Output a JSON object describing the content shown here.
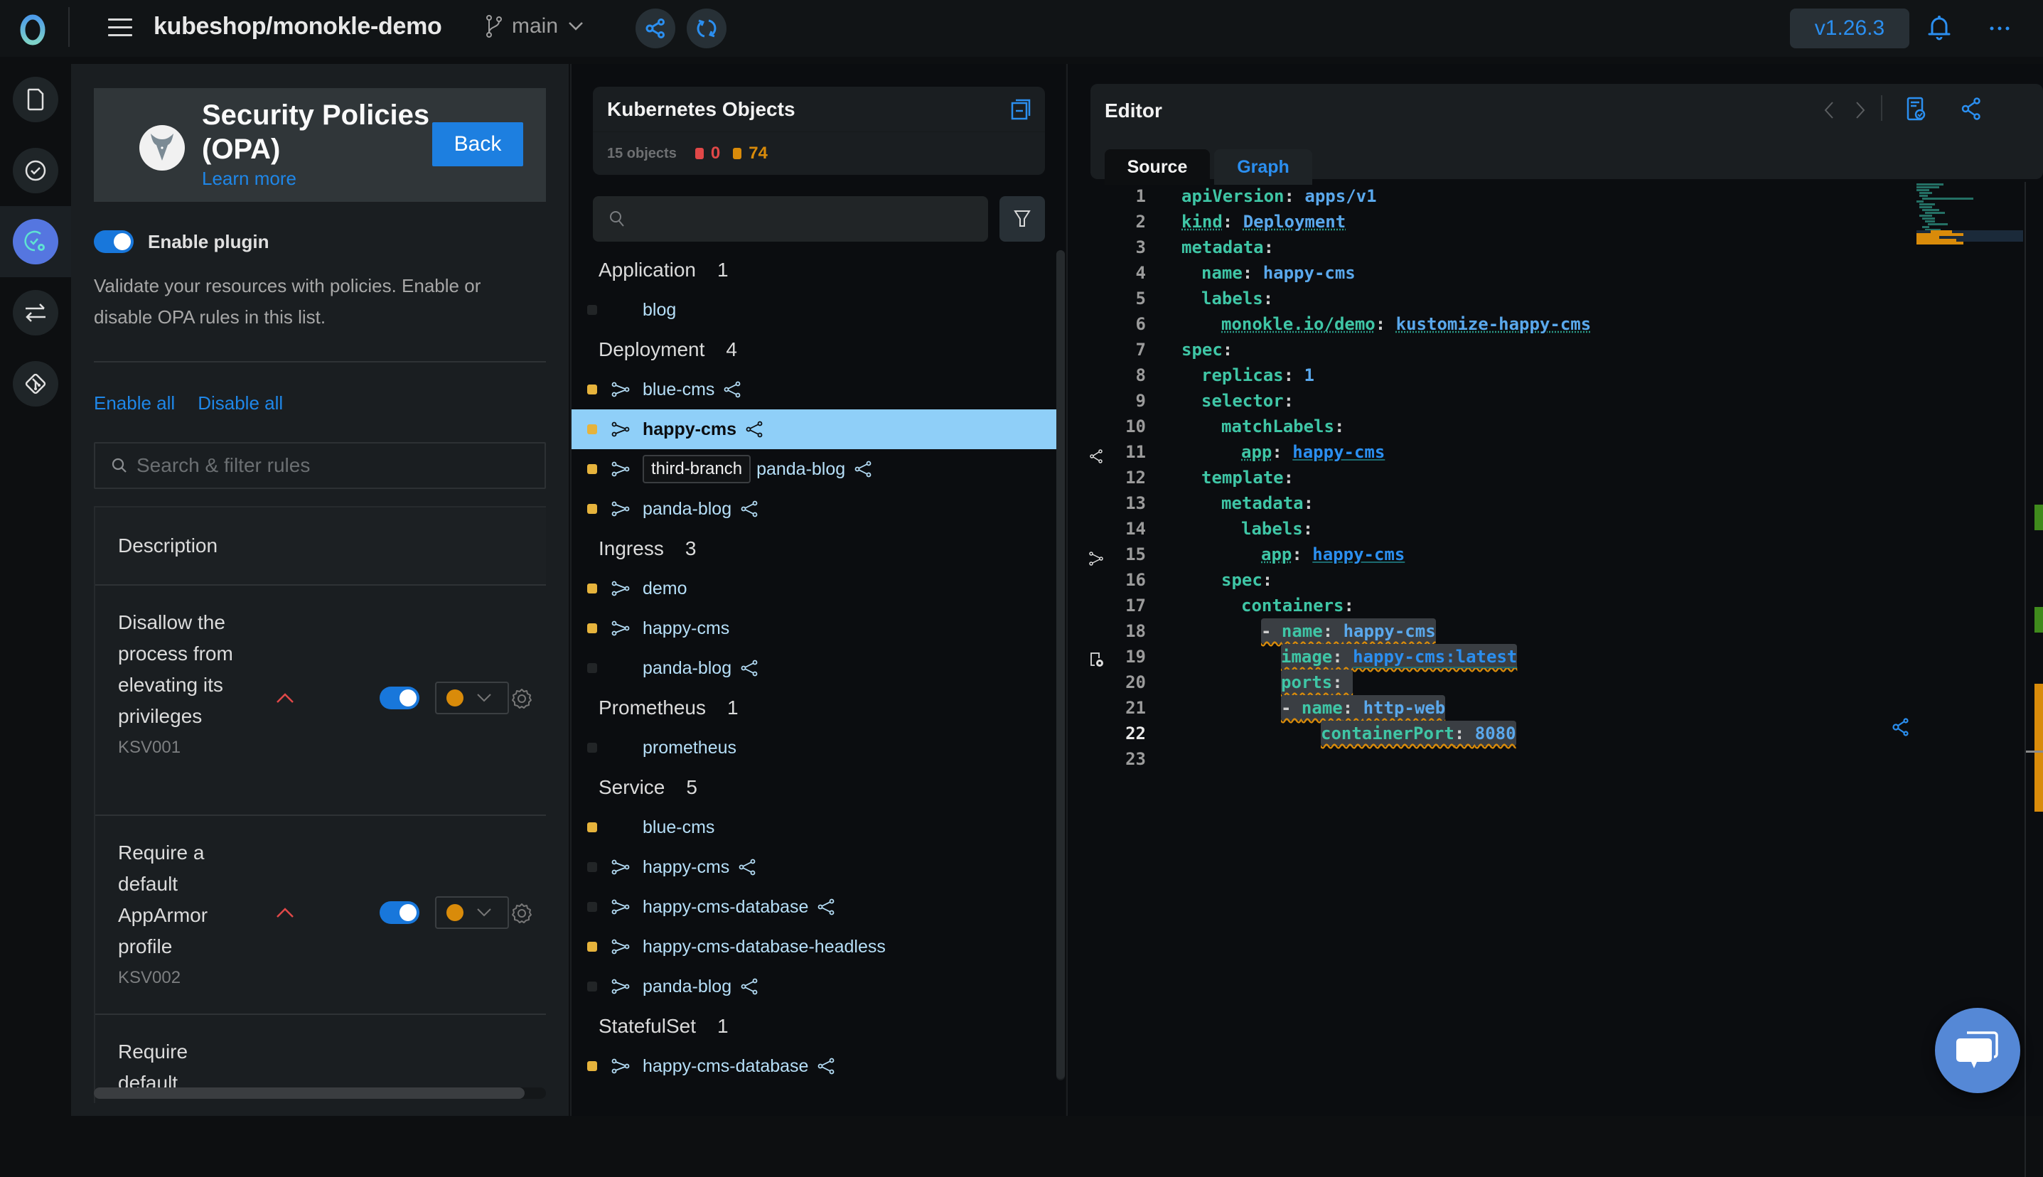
{
  "topbar": {
    "project": "kubeshop/monokle-demo",
    "branch": "main",
    "version": "v1.26.3",
    "icons": {
      "logo": "monokle-logo-icon",
      "menu": "hamburger-menu-icon",
      "branch": "git-branch-icon",
      "share": "share-graph-icon",
      "sync": "sync-icon",
      "bell": "bell-icon",
      "more": "more-dots-icon"
    }
  },
  "rail": {
    "items": [
      {
        "name": "files",
        "icon": "file-icon",
        "active": false
      },
      {
        "name": "validation",
        "icon": "check-circle-icon",
        "active": false
      },
      {
        "name": "policies",
        "icon": "check-gear-icon",
        "active": true
      },
      {
        "name": "compare",
        "icon": "compare-arrows-icon",
        "active": false
      },
      {
        "name": "git",
        "icon": "git-icon",
        "active": false
      }
    ]
  },
  "plugin": {
    "title": "Security Policies (OPA)",
    "learn_more": "Learn more",
    "back": "Back",
    "enable_label": "Enable plugin",
    "enabled": true,
    "description": "Validate your resources with policies. Enable or disable OPA rules in this list.",
    "enable_all": "Enable all",
    "disable_all": "Disable all",
    "search_placeholder": "Search & filter rules",
    "table_header": "Description",
    "rules": [
      {
        "text": "Disallow the process from elevating its privileges",
        "id": "KSV001",
        "severity": "high",
        "enabled": true,
        "level_color": "#d98b0a"
      },
      {
        "text": "Require a default AppArmor profile",
        "id": "KSV002",
        "severity": "high",
        "enabled": true,
        "level_color": "#d98b0a"
      },
      {
        "text": "Require default",
        "id": "",
        "severity": "",
        "enabled": true,
        "level_color": ""
      }
    ]
  },
  "objects": {
    "title": "Kubernetes Objects",
    "count_label": "15 objects",
    "errors": "0",
    "warnings": "74",
    "search_value": "",
    "groups": [
      {
        "kind": "Application",
        "count": "1",
        "items": [
          {
            "name": "blog",
            "warn": false,
            "incoming": false,
            "outgoing": false
          }
        ]
      },
      {
        "kind": "Deployment",
        "count": "4",
        "items": [
          {
            "name": "blue-cms",
            "warn": true,
            "incoming": true,
            "outgoing": true
          },
          {
            "name": "happy-cms",
            "warn": true,
            "incoming": true,
            "outgoing": true,
            "selected": true
          },
          {
            "name": "panda-blog",
            "warn": true,
            "incoming": true,
            "outgoing": true,
            "branch": "third-branch"
          },
          {
            "name": "panda-blog",
            "warn": true,
            "incoming": true,
            "outgoing": true
          }
        ]
      },
      {
        "kind": "Ingress",
        "count": "3",
        "items": [
          {
            "name": "demo",
            "warn": true,
            "incoming": true,
            "outgoing": false
          },
          {
            "name": "happy-cms",
            "warn": true,
            "incoming": true,
            "outgoing": false
          },
          {
            "name": "panda-blog",
            "warn": false,
            "incoming": false,
            "outgoing": true
          }
        ]
      },
      {
        "kind": "Prometheus",
        "count": "1",
        "items": [
          {
            "name": "prometheus",
            "warn": false,
            "incoming": false,
            "outgoing": false
          }
        ]
      },
      {
        "kind": "Service",
        "count": "5",
        "items": [
          {
            "name": "blue-cms",
            "warn": true,
            "incoming": false,
            "outgoing": false
          },
          {
            "name": "happy-cms",
            "warn": false,
            "incoming": true,
            "outgoing": true
          },
          {
            "name": "happy-cms-database",
            "warn": false,
            "incoming": true,
            "outgoing": true
          },
          {
            "name": "happy-cms-database-headless",
            "warn": true,
            "incoming": true,
            "outgoing": false
          },
          {
            "name": "panda-blog",
            "warn": false,
            "incoming": true,
            "outgoing": true
          }
        ]
      },
      {
        "kind": "StatefulSet",
        "count": "1",
        "items": [
          {
            "name": "happy-cms-database",
            "warn": true,
            "incoming": true,
            "outgoing": true
          }
        ]
      }
    ]
  },
  "editor": {
    "title": "Editor",
    "tabs": [
      {
        "label": "Source",
        "active": true
      },
      {
        "label": "Graph",
        "active": false
      }
    ],
    "current_line": 22,
    "lines": [
      {
        "n": "1",
        "indent": 0,
        "key": "apiVersion",
        "val": "apps/v1"
      },
      {
        "n": "2",
        "indent": 0,
        "key": "kind",
        "val": "Deployment",
        "dotted": true
      },
      {
        "n": "3",
        "indent": 0,
        "key": "metadata",
        "val": ""
      },
      {
        "n": "4",
        "indent": 1,
        "key": "name",
        "val": "happy-cms"
      },
      {
        "n": "5",
        "indent": 1,
        "key": "labels",
        "val": ""
      },
      {
        "n": "6",
        "indent": 2,
        "key": "monokle.io/demo",
        "val": "kustomize-happy-cms",
        "dotted": true
      },
      {
        "n": "7",
        "indent": 0,
        "key": "spec",
        "val": ""
      },
      {
        "n": "8",
        "indent": 1,
        "key": "replicas",
        "val": "1"
      },
      {
        "n": "9",
        "indent": 1,
        "key": "selector",
        "val": ""
      },
      {
        "n": "10",
        "indent": 2,
        "key": "matchLabels",
        "val": ""
      },
      {
        "n": "11",
        "indent": 3,
        "key": "app",
        "val": "happy-cms",
        "link": true,
        "gutter": "outgoing-link-icon"
      },
      {
        "n": "12",
        "indent": 1,
        "key": "template",
        "val": ""
      },
      {
        "n": "13",
        "indent": 2,
        "key": "metadata",
        "val": ""
      },
      {
        "n": "14",
        "indent": 3,
        "key": "labels",
        "val": ""
      },
      {
        "n": "15",
        "indent": 4,
        "key": "app",
        "val": "happy-cms",
        "link": true,
        "gutter": "incoming-link-icon"
      },
      {
        "n": "16",
        "indent": 2,
        "key": "spec",
        "val": ""
      },
      {
        "n": "17",
        "indent": 3,
        "key": "containers",
        "val": ""
      },
      {
        "n": "18",
        "indent": 4,
        "dash": true,
        "key": "name",
        "val": "happy-cms",
        "warn": true
      },
      {
        "n": "19",
        "indent": 5,
        "key": "image",
        "val": "happy-cms:latest",
        "link": true,
        "warn": true,
        "gutter": "image-icon"
      },
      {
        "n": "20",
        "indent": 5,
        "key": "ports",
        "val": "",
        "warn": true
      },
      {
        "n": "21",
        "indent": 5,
        "dash": true,
        "key": "name",
        "val": "http-web",
        "warn": true
      },
      {
        "n": "22",
        "indent": 7,
        "key": "containerPort",
        "val": "8080",
        "warn": true
      },
      {
        "n": "23",
        "indent": 0,
        "key": "",
        "val": ""
      }
    ]
  },
  "colors": {
    "accent": "#1f87e8",
    "warning": "#d98b0a",
    "error": "#e04848",
    "selected_row": "#8fcff8",
    "active_rail": "#5576e0"
  }
}
